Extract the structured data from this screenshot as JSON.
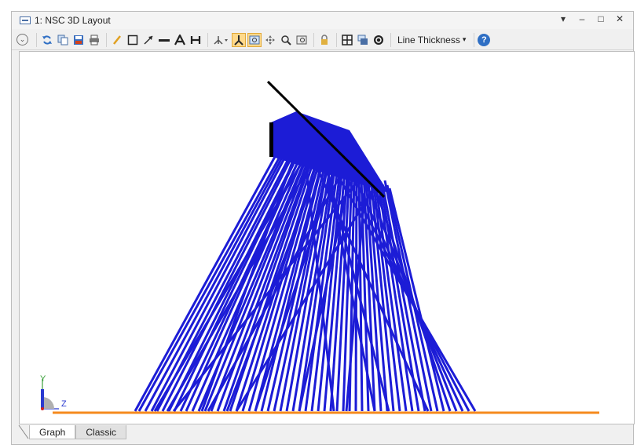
{
  "window": {
    "title": "1: NSC 3D Layout",
    "controls": [
      "▾",
      "–",
      "□",
      "✕"
    ]
  },
  "toolbar": {
    "line_thickness_label": "Line Thickness",
    "dropdown_arrow": "▾",
    "help_label": "?",
    "settings_chevron": "⌄"
  },
  "axes": {
    "y_label": "Y",
    "z_label": "Z"
  },
  "tabs": [
    {
      "label": "Graph",
      "active": true
    },
    {
      "label": "Classic",
      "active": false
    }
  ],
  "colors": {
    "rays": "#1c1cd6",
    "detector": "#f58a1e",
    "mirror": "#000000",
    "y_axis": "#3ca03c",
    "z_axis": "#2a3ad0"
  }
}
